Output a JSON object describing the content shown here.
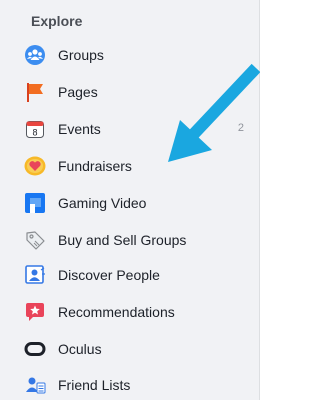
{
  "section_title": "Explore",
  "accent_arrow_color": "#1aa7e0",
  "items": [
    {
      "label": "Groups",
      "icon": "groups-icon"
    },
    {
      "label": "Pages",
      "icon": "pages-flag-icon"
    },
    {
      "label": "Events",
      "icon": "calendar-icon",
      "badge": "8",
      "count": "2"
    },
    {
      "label": "Fundraisers",
      "icon": "heart-coin-icon"
    },
    {
      "label": "Gaming Video",
      "icon": "gaming-video-icon"
    },
    {
      "label": "Buy and Sell Groups",
      "icon": "price-tag-icon"
    },
    {
      "label": "Discover People",
      "icon": "discover-people-icon"
    },
    {
      "label": "Recommendations",
      "icon": "recommendations-icon"
    },
    {
      "label": "Oculus",
      "icon": "oculus-icon"
    },
    {
      "label": "Friend Lists",
      "icon": "friend-lists-icon"
    }
  ]
}
